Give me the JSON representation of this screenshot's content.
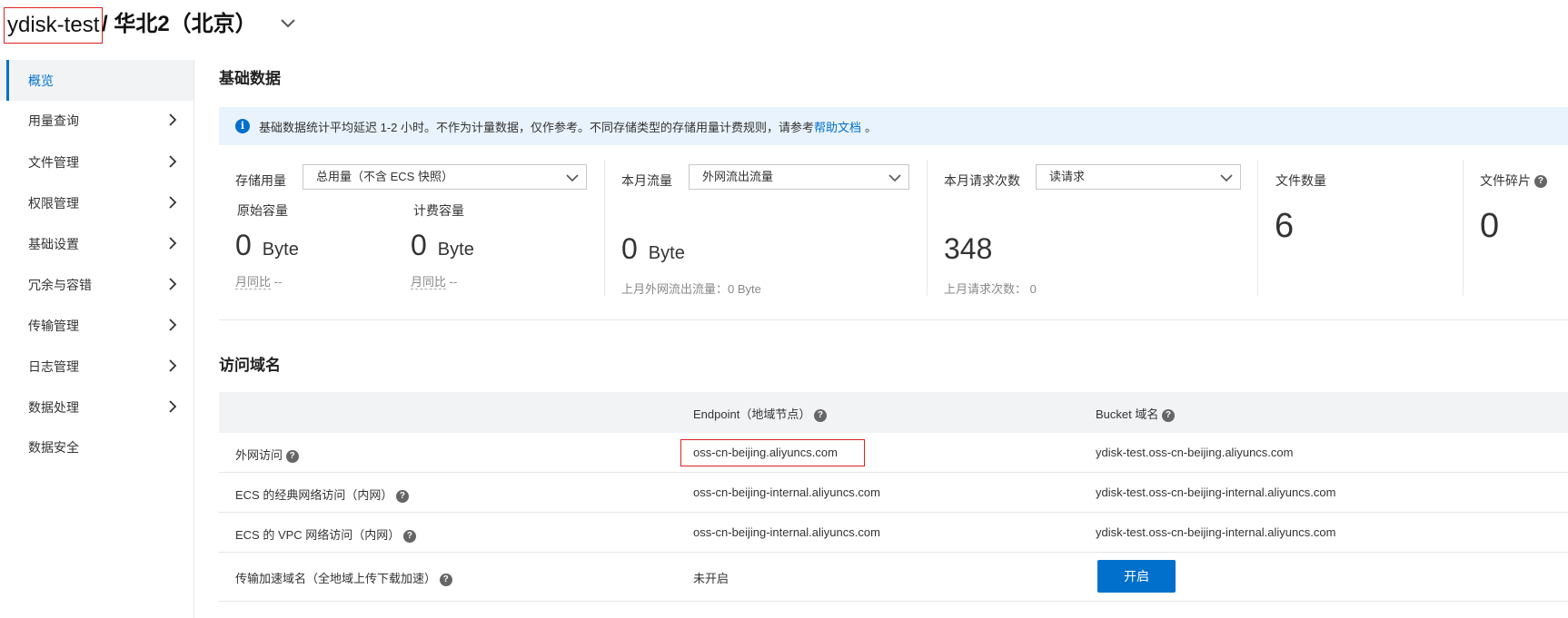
{
  "header": {
    "bucket_name": "ydisk-test",
    "separator_region": "/ 华北2（北京）"
  },
  "sidebar": {
    "items": [
      {
        "label": "概览",
        "active": true
      },
      {
        "label": "用量查询",
        "has_children": true
      },
      {
        "label": "文件管理",
        "has_children": true
      },
      {
        "label": "权限管理",
        "has_children": true
      },
      {
        "label": "基础设置",
        "has_children": true
      },
      {
        "label": "冗余与容错",
        "has_children": true
      },
      {
        "label": "传输管理",
        "has_children": true
      },
      {
        "label": "日志管理",
        "has_children": true
      },
      {
        "label": "数据处理",
        "has_children": true
      },
      {
        "label": "数据安全",
        "has_children": false
      }
    ]
  },
  "basic_data": {
    "title": "基础数据",
    "info_text": "基础数据统计平均延迟 1-2 小时。不作为计量数据，仅作参考。不同存储类型的存储用量计费规则，请参考",
    "info_link": "帮助文档",
    "info_suffix": "。",
    "storage": {
      "label": "存储用量",
      "select_value": "总用量（不含 ECS 快照）",
      "raw_label": "原始容量",
      "raw_value": "0",
      "raw_unit": "Byte",
      "raw_compare_label": "月同比",
      "raw_compare_value": "--",
      "billed_label": "计费容量",
      "billed_value": "0",
      "billed_unit": "Byte",
      "billed_compare_label": "月同比",
      "billed_compare_value": "--"
    },
    "traffic": {
      "label": "本月流量",
      "select_value": "外网流出流量",
      "value": "0",
      "unit": "Byte",
      "last_month": "上月外网流出流量：0 Byte"
    },
    "requests": {
      "label": "本月请求次数",
      "select_value": "读请求",
      "value": "348",
      "last_month_label": "上月请求次数：",
      "last_month_value": "0"
    },
    "files": {
      "label": "文件数量",
      "value": "6"
    },
    "fragments": {
      "label": "文件碎片",
      "value": "0"
    }
  },
  "domains": {
    "title": "访问域名",
    "col_endpoint": "Endpoint（地域节点）",
    "col_bucket": "Bucket 域名",
    "rows": [
      {
        "name": "外网访问",
        "endpoint": "oss-cn-beijing.aliyuncs.com",
        "bucket": "ydisk-test.oss-cn-beijing.aliyuncs.com"
      },
      {
        "name": "ECS 的经典网络访问（内网）",
        "endpoint": "oss-cn-beijing-internal.aliyuncs.com",
        "bucket": "ydisk-test.oss-cn-beijing-internal.aliyuncs.com"
      },
      {
        "name": "ECS 的 VPC 网络访问（内网）",
        "endpoint": "oss-cn-beijing-internal.aliyuncs.com",
        "bucket": "ydisk-test.oss-cn-beijing-internal.aliyuncs.com"
      },
      {
        "name": "传输加速域名（全地域上传下载加速）",
        "endpoint": "未开启",
        "button": "开启"
      }
    ]
  },
  "colors": {
    "accent": "#0070cc",
    "highlight_border": "#e02020",
    "info_bg": "#e8f3fd"
  }
}
